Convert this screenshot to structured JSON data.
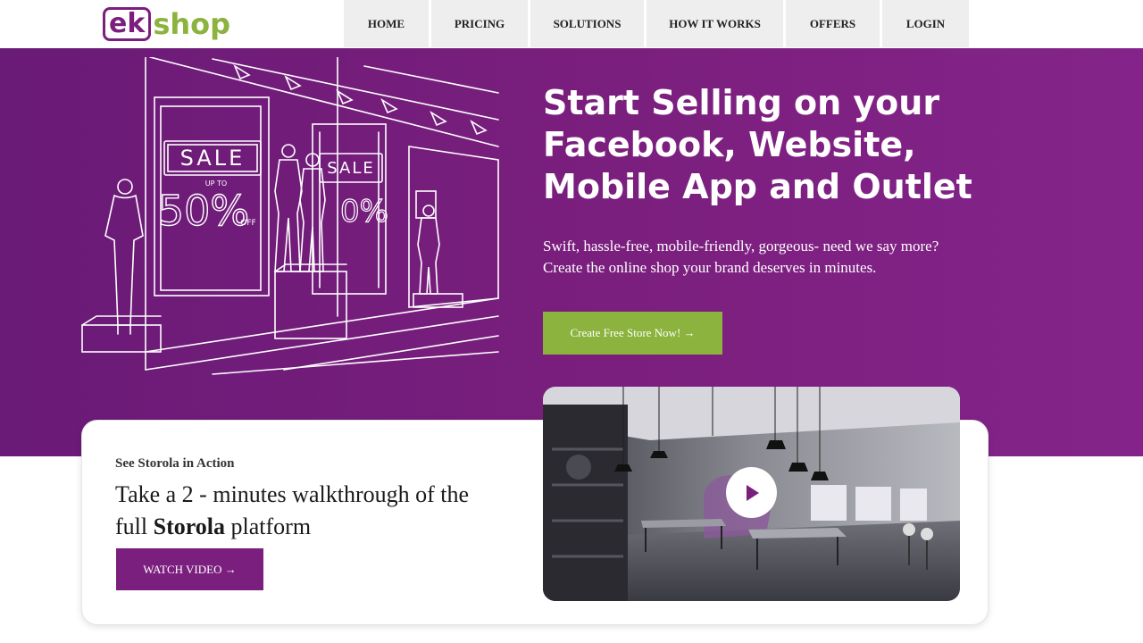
{
  "brand": {
    "logo_ek": "ek",
    "logo_shop": "shop",
    "purple": "#7b1f7e",
    "green": "#8bb33e"
  },
  "nav": {
    "items": [
      {
        "label": "HOME"
      },
      {
        "label": "PRICING"
      },
      {
        "label": "SOLUTIONS"
      },
      {
        "label": "HOW IT WORKS"
      },
      {
        "label": "OFFERS"
      },
      {
        "label": "LOGIN"
      }
    ]
  },
  "hero": {
    "title_line1": "Start Selling on your",
    "title_line2": "Facebook, Website,",
    "title_line3": "Mobile App and Outlet",
    "sub_line1": "Swift, hassle-free, mobile-friendly, gorgeous- need we say more?",
    "sub_line2": "Create the online shop your brand deserves in minutes.",
    "cta_label": "Create Free Store Now! →",
    "illustration": {
      "sign1": "SALE",
      "sign2": "SALE",
      "upto": "UP TO",
      "percent": "50%",
      "off": "OFF"
    }
  },
  "walkthrough": {
    "kicker": "See Storola in Action",
    "title_prefix": "Take a 2 - minutes walkthrough of the full ",
    "title_bold": "Storola",
    "title_suffix": " platform",
    "button_label": "WATCH VIDEO →",
    "play_icon": "play-icon"
  }
}
